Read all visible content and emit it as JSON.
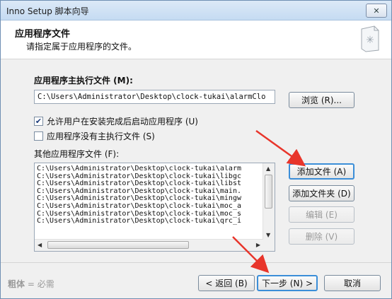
{
  "window": {
    "title": "Inno Setup 脚本向导",
    "close_glyph": "✕"
  },
  "header": {
    "title": "应用程序文件",
    "subtitle": "请指定属于应用程序的文件。"
  },
  "main_exe": {
    "label": "应用程序主执行文件 (M):",
    "value": "C:\\Users\\Administrator\\Desktop\\clock-tukai\\alarmClo",
    "browse_label": "浏览 (R)..."
  },
  "options": {
    "allow_launch": {
      "label": "允许用户在安装完成后启动应用程序 (U)",
      "checked": true
    },
    "no_main_exe": {
      "label": "应用程序没有主执行文件 (S)",
      "checked": false
    }
  },
  "other_files": {
    "label": "其他应用程序文件 (F):",
    "items": [
      "C:\\Users\\Administrator\\Desktop\\clock-tukai\\alarm",
      "C:\\Users\\Administrator\\Desktop\\clock-tukai\\libgc",
      "C:\\Users\\Administrator\\Desktop\\clock-tukai\\libst",
      "C:\\Users\\Administrator\\Desktop\\clock-tukai\\main.",
      "C:\\Users\\Administrator\\Desktop\\clock-tukai\\mingw",
      "C:\\Users\\Administrator\\Desktop\\clock-tukai\\moc_a",
      "C:\\Users\\Administrator\\Desktop\\clock-tukai\\moc_s",
      "C:\\Users\\Administrator\\Desktop\\clock-tukai\\qrc_i"
    ],
    "buttons": {
      "add_file": "添加文件 (A)",
      "add_folder": "添加文件夹 (D)",
      "edit": "编辑 (E)",
      "delete": "删除 (V)"
    }
  },
  "footer": {
    "note_bold": "粗体",
    "note_rest": " = 必需",
    "back": "< 返回 (B)",
    "next": "下一步 (N) >",
    "cancel": "取消"
  },
  "colors": {
    "annotation_arrow": "#e8352b",
    "focus_border": "#3b8ed8"
  }
}
